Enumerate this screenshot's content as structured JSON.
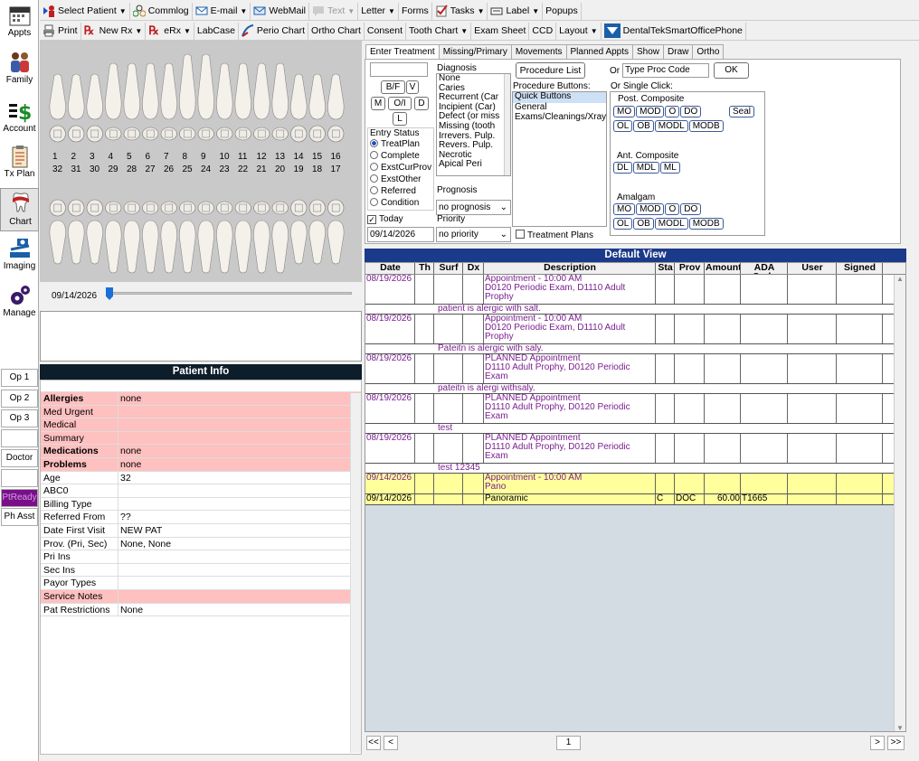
{
  "modules": [
    {
      "label": "Appts",
      "icon": "calendar-icon"
    },
    {
      "label": "Family",
      "icon": "family-icon"
    },
    {
      "label": "Account",
      "icon": "dollar-icon"
    },
    {
      "label": "Tx Plan",
      "icon": "clipboard-icon"
    },
    {
      "label": "Chart",
      "icon": "tooth-icon"
    },
    {
      "label": "Imaging",
      "icon": "scanner-icon"
    },
    {
      "label": "Manage",
      "icon": "gears-icon"
    }
  ],
  "ops": [
    "Op 1",
    "Op 2",
    "Op 3",
    "",
    "Doctor",
    "",
    "PtReady",
    "Ph Asst"
  ],
  "toolbar1": {
    "select_patient": "Select Patient",
    "commlog": "Commlog",
    "email": "E-mail",
    "webmail": "WebMail",
    "text": "Text",
    "letter": "Letter",
    "forms": "Forms",
    "tasks": "Tasks",
    "label": "Label",
    "popups": "Popups"
  },
  "toolbar2": {
    "print": "Print",
    "newrx": "New Rx",
    "erx": "eRx",
    "labcase": "LabCase",
    "perio": "Perio Chart",
    "ortho": "Ortho Chart",
    "consent": "Consent",
    "toothchart": "Tooth Chart",
    "examsheet": "Exam Sheet",
    "ccd": "CCD",
    "layout": "Layout",
    "phone": "DentalTekSmartOfficePhone"
  },
  "upper_numbers": [
    "1",
    "2",
    "3",
    "4",
    "5",
    "6",
    "7",
    "8",
    "9",
    "10",
    "11",
    "12",
    "13",
    "14",
    "15",
    "16"
  ],
  "lower_numbers": [
    "32",
    "31",
    "30",
    "29",
    "28",
    "27",
    "26",
    "25",
    "24",
    "23",
    "22",
    "21",
    "20",
    "19",
    "18",
    "17"
  ],
  "slider_date": "09/14/2026",
  "patient_info_title": "Patient Info",
  "patient_info": [
    {
      "k": "Allergies",
      "v": "none",
      "style": "pink bold"
    },
    {
      "k": "Med Urgent",
      "v": "",
      "style": "pink"
    },
    {
      "k": "Medical",
      "v": "",
      "style": "pink"
    },
    {
      "k": "Summary",
      "v": "",
      "style": "pink"
    },
    {
      "k": "Medications",
      "v": "none",
      "style": "pink bold"
    },
    {
      "k": "Problems",
      "v": "none",
      "style": "pink bold"
    },
    {
      "k": "Age",
      "v": "32",
      "style": ""
    },
    {
      "k": "ABC0",
      "v": "",
      "style": ""
    },
    {
      "k": "Billing Type",
      "v": "",
      "style": ""
    },
    {
      "k": "Referred From",
      "v": "??",
      "style": ""
    },
    {
      "k": "Date First Visit",
      "v": "NEW PAT",
      "style": ""
    },
    {
      "k": "Prov. (Pri, Sec)",
      "v": "None, None",
      "style": ""
    },
    {
      "k": "Pri Ins",
      "v": "",
      "style": ""
    },
    {
      "k": "Sec Ins",
      "v": "",
      "style": ""
    },
    {
      "k": "Payor Types",
      "v": "",
      "style": ""
    },
    {
      "k": "Service Notes",
      "v": "",
      "style": "pink"
    },
    {
      "k": "Pat Restrictions",
      "v": "None",
      "style": ""
    }
  ],
  "tabs": [
    "Enter Treatment",
    "Missing/Primary",
    "Movements",
    "Planned Appts",
    "Show",
    "Draw",
    "Ortho"
  ],
  "entry": {
    "surf_buttons": [
      "B/F",
      "V",
      "M",
      "O/I",
      "D",
      "L"
    ],
    "entry_status_label": "Entry Status",
    "statuses": [
      "TreatPlan",
      "Complete",
      "ExstCurProv",
      "ExstOther",
      "Referred",
      "Condition"
    ],
    "today_label": "Today",
    "date_value": "09/14/2026",
    "diagnosis_label": "Diagnosis",
    "diagnoses": [
      "None",
      "Caries",
      "Recurrent (Car",
      "Incipient (Car)",
      "Defect (or miss",
      "Missing (tooth",
      "Irrevers. Pulp.",
      "Revers. Pulp.",
      "Necrotic",
      "Apical Peri"
    ],
    "prognosis_label": "Prognosis",
    "prognosis_value": "no prognosis",
    "priority_label": "Priority",
    "priority_value": "no priority",
    "procedure_list": "Procedure List",
    "or_label": "Or",
    "proc_code_placeholder": "Type Proc Code",
    "ok": "OK",
    "proc_buttons_label": "Procedure Buttons:",
    "proc_categories": [
      "Quick Buttons",
      "General",
      "Exams/Cleanings/Xray"
    ],
    "single_click_label": "Or Single Click:",
    "post_comp_label": "Post. Composite",
    "post_comp_row1": [
      "MO",
      "MOD",
      "O",
      "DO"
    ],
    "seal": "Seal",
    "post_comp_row2": [
      "OL",
      "OB",
      "MODL",
      "MODB"
    ],
    "ant_comp_label": "Ant. Composite",
    "ant_comp_row": [
      "DL",
      "MDL",
      "ML"
    ],
    "amalgam_label": "Amalgam",
    "amalgam_row1": [
      "MO",
      "MOD",
      "O",
      "DO"
    ],
    "amalgam_row2": [
      "OL",
      "OB",
      "MODL",
      "MODB"
    ],
    "treatment_plans": "Treatment Plans"
  },
  "grid_title": "Default View",
  "grid_columns": [
    "Date",
    "Th",
    "Surf",
    "Dx",
    "Description",
    "Sta",
    "Prov",
    "Amount",
    "ADA Code",
    "User",
    "Signed"
  ],
  "grid_rows": [
    {
      "date": "08/19/2026",
      "desc": [
        "Appointment - 10:00 AM",
        "D0120 Periodic Exam, D1110 Adult",
        "Prophy"
      ],
      "note": "patient is alergic with salt.",
      "yellow": false
    },
    {
      "date": "08/19/2026",
      "desc": [
        "Appointment - 10:00 AM",
        "D0120 Periodic Exam, D1110 Adult",
        "Prophy"
      ],
      "note": "Pateitn is alergic with saly.",
      "yellow": false
    },
    {
      "date": "08/19/2026",
      "desc": [
        "PLANNED Appointment",
        "D1110 Adult Prophy, D0120 Periodic",
        "Exam"
      ],
      "note": "pateitn is alergi withsaly.",
      "yellow": false
    },
    {
      "date": "08/19/2026",
      "desc": [
        "PLANNED Appointment",
        "D1110 Adult Prophy, D0120 Periodic",
        "Exam"
      ],
      "note": "test",
      "yellow": false
    },
    {
      "date": "08/19/2026",
      "desc": [
        "PLANNED Appointment",
        "D1110 Adult Prophy, D0120 Periodic",
        "Exam"
      ],
      "note": "test 12345",
      "yellow": false
    },
    {
      "date": "09/14/2026",
      "desc": [
        "Appointment - 10:00 AM",
        "Pano"
      ],
      "note": "",
      "yellow": true
    }
  ],
  "proc_row": {
    "date": "09/14/2026",
    "desc": "Panoramic",
    "sta": "C",
    "prov": "DOC",
    "amount": "60.00",
    "code": "T1665"
  },
  "pager": {
    "first": "<<",
    "prev": "<",
    "page": "1",
    "next": ">",
    "last": ">>"
  }
}
